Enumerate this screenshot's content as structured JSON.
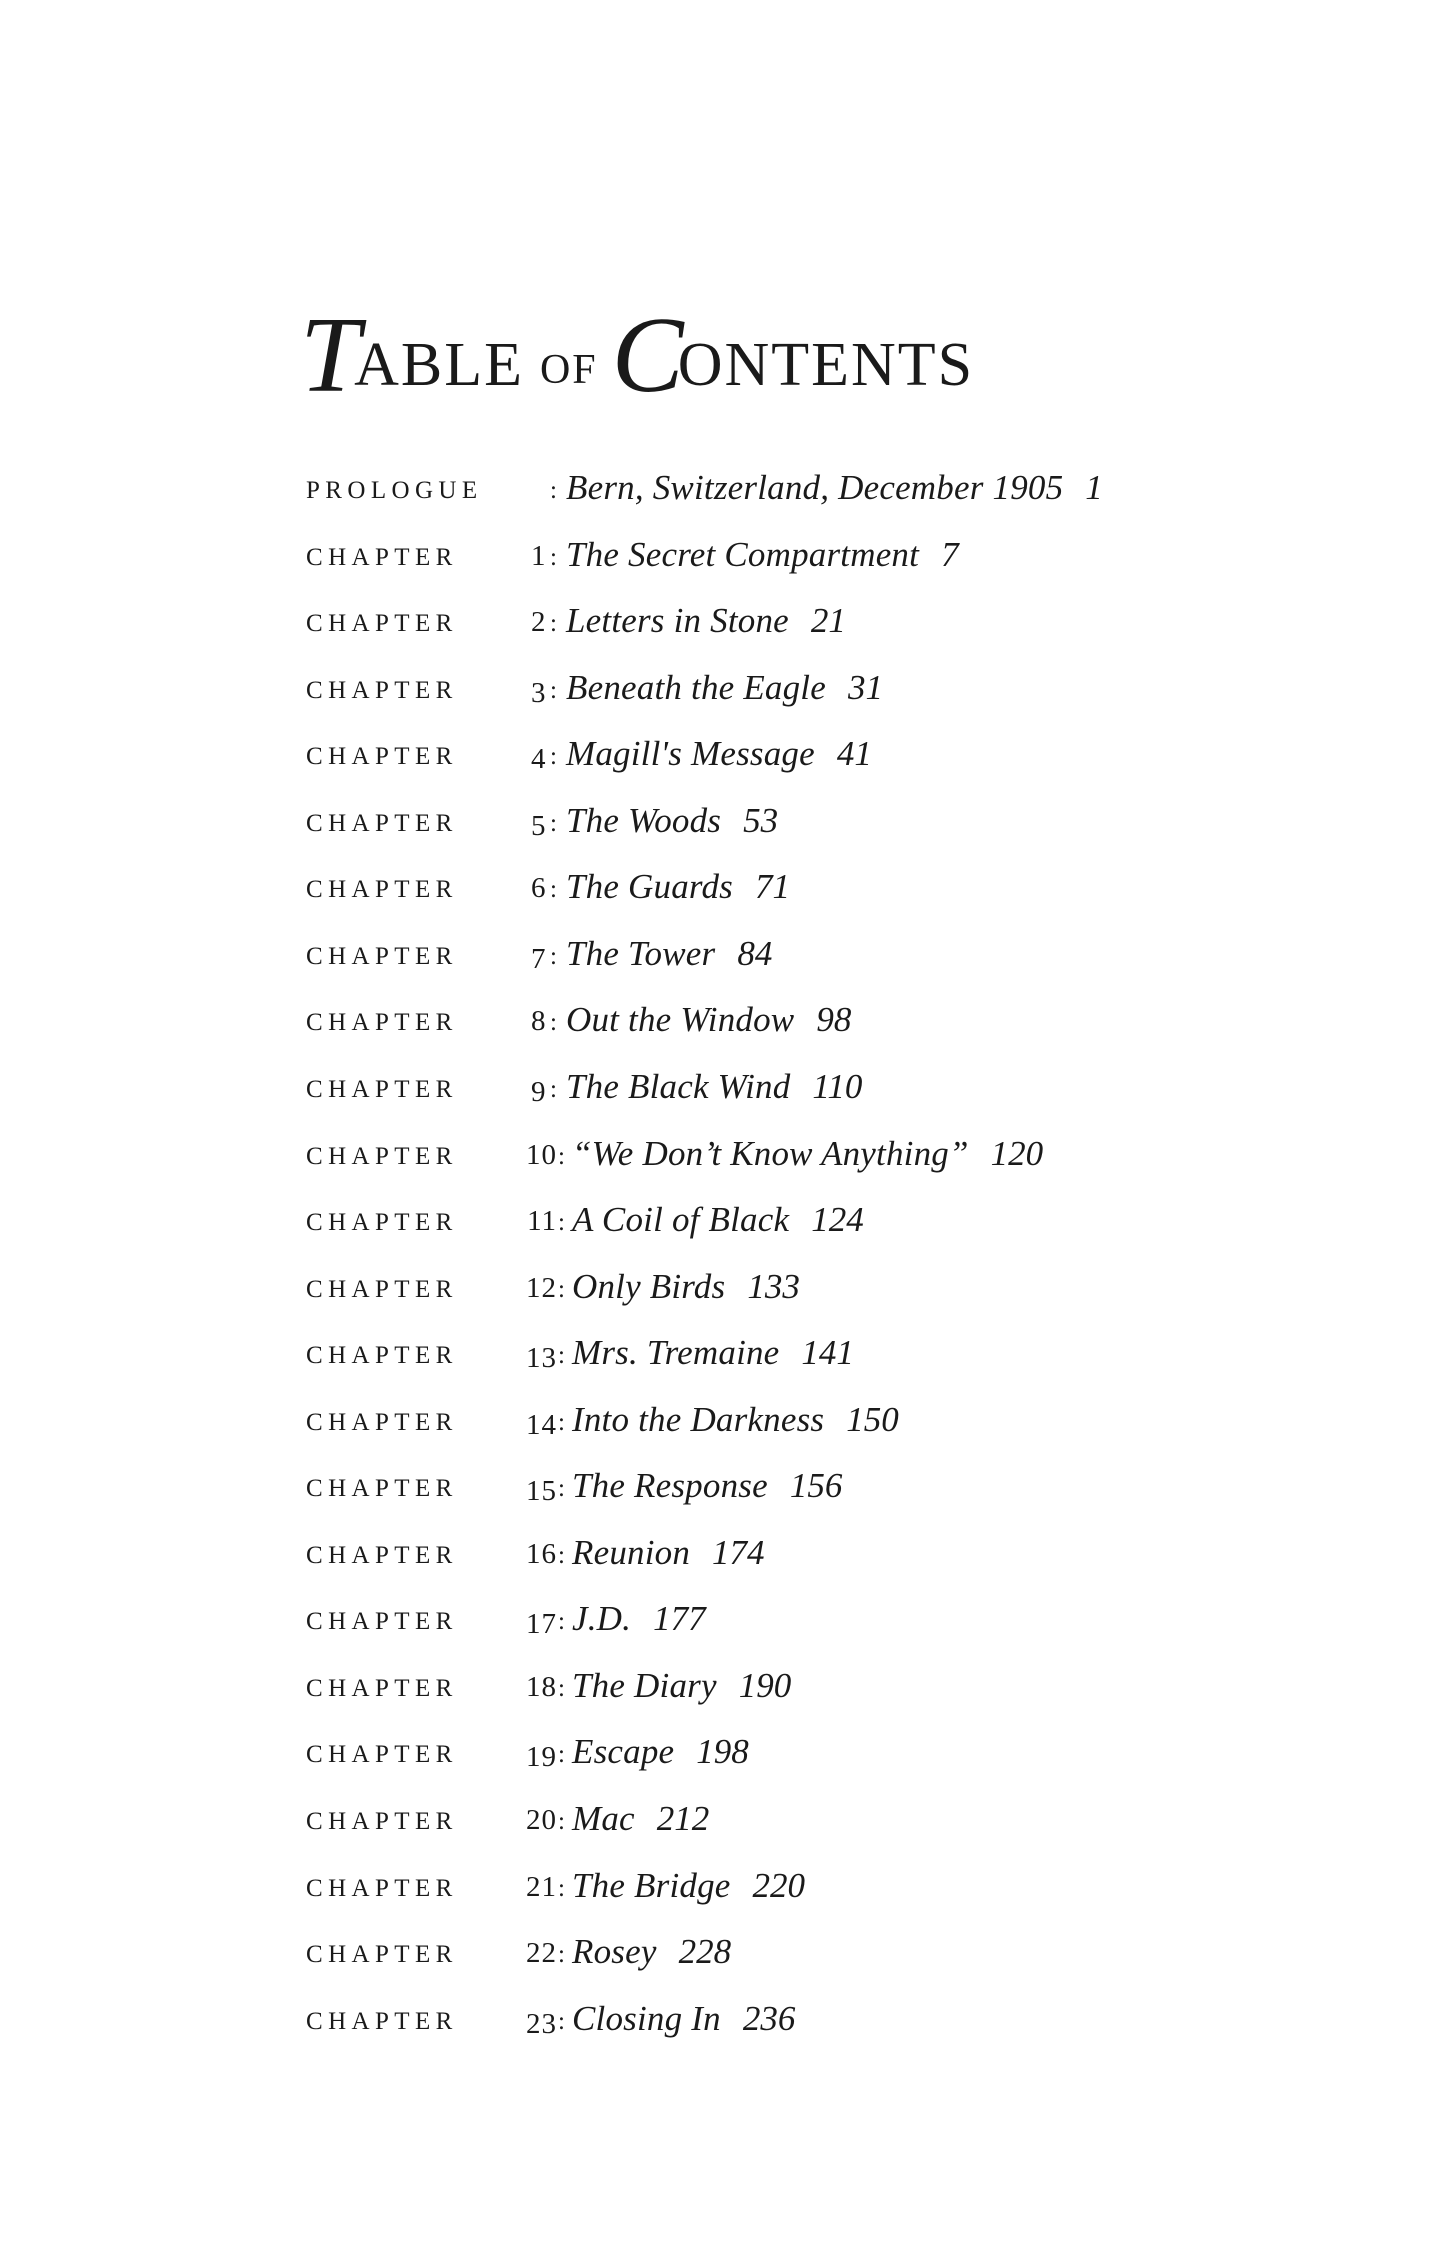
{
  "page": {
    "background_color": "#ffffff",
    "text_color": "#1a1a1a"
  },
  "title": {
    "full_text": "TABLE OF CONTENTS",
    "word1_initial": "T",
    "word1_rest": "ABLE",
    "connector": "OF",
    "word2_initial": "C",
    "word2_rest": "ONTENTS"
  },
  "entries": [
    {
      "label": "PROLOGUE",
      "number": "",
      "colon": ":",
      "title": "Bern, Switzerland, December 1905",
      "page": "1"
    },
    {
      "label": "CHAPTER",
      "number": "1",
      "colon": ":",
      "title": "The Secret Compartment",
      "page": "7"
    },
    {
      "label": "CHAPTER",
      "number": "2",
      "colon": ":",
      "title": "Letters in Stone",
      "page": "21"
    },
    {
      "label": "CHAPTER",
      "number": "3",
      "colon": ":",
      "title": "Beneath the Eagle",
      "page": "31"
    },
    {
      "label": "CHAPTER",
      "number": "4",
      "colon": ":",
      "title": "Magill's Message",
      "page": "41"
    },
    {
      "label": "CHAPTER",
      "number": "5",
      "colon": ":",
      "title": "The Woods",
      "page": "53"
    },
    {
      "label": "CHAPTER",
      "number": "6",
      "colon": ":",
      "title": "The Guards",
      "page": "71"
    },
    {
      "label": "CHAPTER",
      "number": "7",
      "colon": ":",
      "title": "The Tower",
      "page": "84"
    },
    {
      "label": "CHAPTER",
      "number": "8",
      "colon": ":",
      "title": "Out the Window",
      "page": "98"
    },
    {
      "label": "CHAPTER",
      "number": "9",
      "colon": ":",
      "title": "The Black Wind",
      "page": "110"
    },
    {
      "label": "CHAPTER",
      "number": "10",
      "colon": ":",
      "title": "“We Don’t Know Anything”",
      "page": "120"
    },
    {
      "label": "CHAPTER",
      "number": "11",
      "colon": ":",
      "title": "A Coil of Black",
      "page": "124"
    },
    {
      "label": "CHAPTER",
      "number": "12",
      "colon": ":",
      "title": "Only Birds",
      "page": "133"
    },
    {
      "label": "CHAPTER",
      "number": "13",
      "colon": ":",
      "title": "Mrs. Tremaine",
      "page": "141"
    },
    {
      "label": "CHAPTER",
      "number": "14",
      "colon": ":",
      "title": "Into the Darkness",
      "page": "150"
    },
    {
      "label": "CHAPTER",
      "number": "15",
      "colon": ":",
      "title": "The Response",
      "page": "156"
    },
    {
      "label": "CHAPTER",
      "number": "16",
      "colon": ":",
      "title": "Reunion",
      "page": "174"
    },
    {
      "label": "CHAPTER",
      "number": "17",
      "colon": ":",
      "title": "J.D.",
      "page": "177"
    },
    {
      "label": "CHAPTER",
      "number": "18",
      "colon": ":",
      "title": "The Diary",
      "page": "190"
    },
    {
      "label": "CHAPTER",
      "number": "19",
      "colon": ":",
      "title": "Escape",
      "page": "198"
    },
    {
      "label": "CHAPTER",
      "number": "20",
      "colon": ":",
      "title": "Mac",
      "page": "212"
    },
    {
      "label": "CHAPTER",
      "number": "21",
      "colon": ":",
      "title": "The Bridge",
      "page": "220"
    },
    {
      "label": "CHAPTER",
      "number": "22",
      "colon": ":",
      "title": "Rosey",
      "page": "228"
    },
    {
      "label": "CHAPTER",
      "number": "23",
      "colon": ":",
      "title": "Closing In",
      "page": "236"
    }
  ]
}
